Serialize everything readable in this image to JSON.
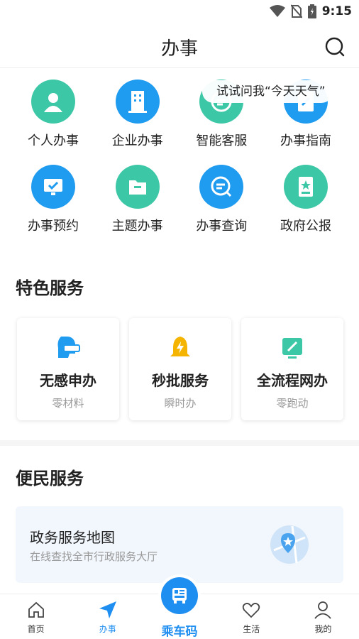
{
  "status_bar": {
    "time": "9:15"
  },
  "header": {
    "title": "办事"
  },
  "hint": "试试问我“今天天气”",
  "grid_items": [
    {
      "label": "个人办事",
      "icon": "person-icon",
      "color": "#3cc8a6"
    },
    {
      "label": "企业办事",
      "icon": "building-icon",
      "color": "#1f9bf0"
    },
    {
      "label": "智能客服",
      "icon": "chat-icon",
      "color": "#3cc8a6"
    },
    {
      "label": "办事指南",
      "icon": "guide-icon",
      "color": "#1f9bf0"
    },
    {
      "label": "办事预约",
      "icon": "monitor-check-icon",
      "color": "#1f9bf0"
    },
    {
      "label": "主题办事",
      "icon": "folder-icon",
      "color": "#3cc8a6"
    },
    {
      "label": "办事查询",
      "icon": "query-icon",
      "color": "#1f9bf0"
    },
    {
      "label": "政府公报",
      "icon": "bulletin-icon",
      "color": "#3cc8a6"
    }
  ],
  "featured": {
    "title": "特色服务",
    "cards": [
      {
        "title": "无感申办",
        "sub": "零材料",
        "icon": "vr-headset-icon",
        "color": "#1f9bf0"
      },
      {
        "title": "秒批服务",
        "sub": "瞬时办",
        "icon": "bell-icon",
        "color": "#f4b400"
      },
      {
        "title": "全流程网办",
        "sub": "零跑动",
        "icon": "edit-screen-icon",
        "color": "#3cc8a6"
      }
    ]
  },
  "convenience": {
    "title": "便民服务",
    "card": {
      "title": "政务服务地图",
      "sub": "在线查找全市行政服务大厅",
      "icon": "map-pin-icon"
    }
  },
  "tabbar": {
    "items": [
      {
        "label": "首页",
        "icon": "home-icon"
      },
      {
        "label": "办事",
        "icon": "navigation-arrow-icon"
      },
      {
        "label": "乘车码",
        "icon": "bus-code-icon"
      },
      {
        "label": "生活",
        "icon": "heart-icon"
      },
      {
        "label": "我的",
        "icon": "user-icon"
      }
    ],
    "active_color": "#1f8ef1"
  }
}
